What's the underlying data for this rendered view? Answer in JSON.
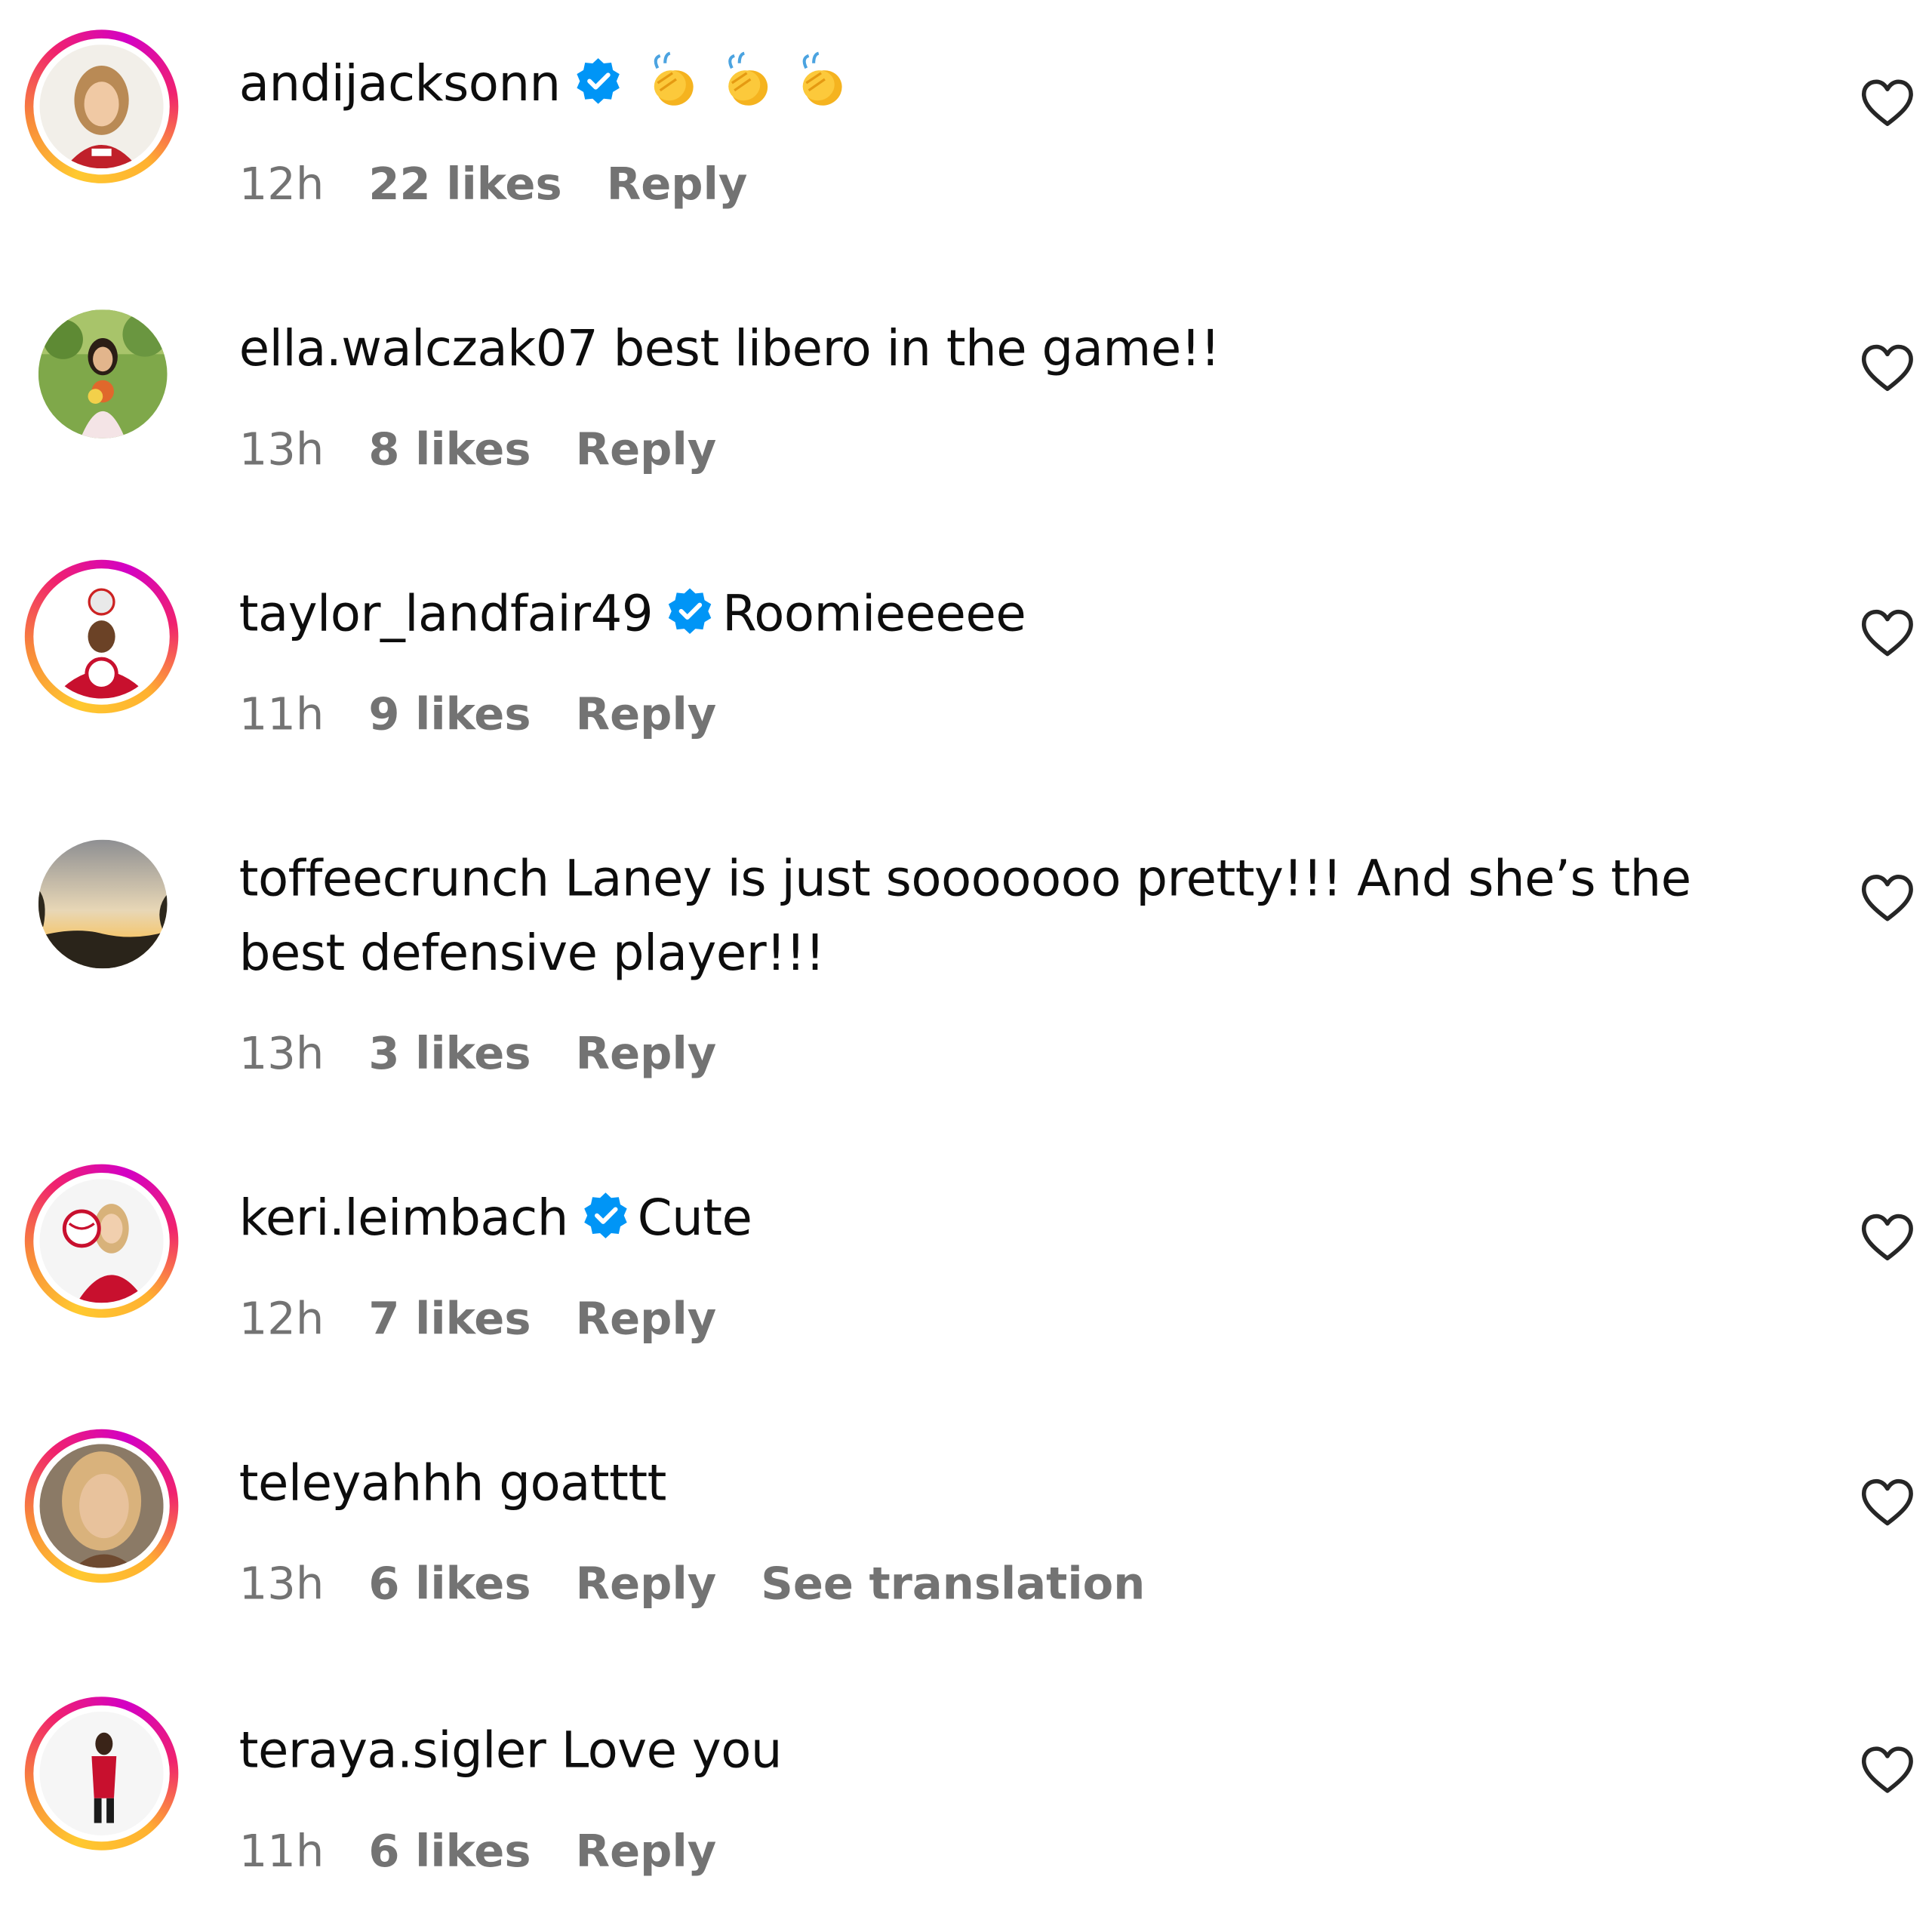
{
  "comments": [
    {
      "username": "andijacksonn",
      "verified": true,
      "text": "",
      "emoji": [
        "clapping-hands",
        "clapping-hands",
        "clapping-hands"
      ],
      "time": "12h",
      "likes": "22 likes",
      "reply": "Reply",
      "avatar_ring": true
    },
    {
      "username": "ella.walczak07",
      "verified": false,
      "text": "best libero in the game!!",
      "time": "13h",
      "likes": "8 likes",
      "reply": "Reply",
      "avatar_ring": false
    },
    {
      "username": "taylor_landfair49",
      "verified": true,
      "text": "Roomieeeee",
      "time": "11h",
      "likes": "9 likes",
      "reply": "Reply",
      "avatar_ring": true
    },
    {
      "username": "toffeecrunch",
      "verified": false,
      "text": "Laney is just sooooooo pretty!!! And she’s the best defensive player!!!",
      "time": "13h",
      "likes": "3 likes",
      "reply": "Reply",
      "avatar_ring": false
    },
    {
      "username": "keri.leimbach",
      "verified": true,
      "text": "Cute",
      "time": "12h",
      "likes": "7 likes",
      "reply": "Reply",
      "avatar_ring": true
    },
    {
      "username": "teleyahhh",
      "verified": false,
      "text": "goatttt",
      "time": "13h",
      "likes": "6 likes",
      "reply": "Reply",
      "see_translation": "See translation",
      "avatar_ring": true
    },
    {
      "username": "teraya.sigler",
      "verified": false,
      "text": "Love you",
      "time": "11h",
      "likes": "6 likes",
      "reply": "Reply",
      "avatar_ring": true
    }
  ],
  "icons": {
    "verified": "verified-badge-icon",
    "like": "heart-outline-icon",
    "emoji": "clapping-hands-emoji"
  },
  "colors": {
    "verified_blue": "#0095f6",
    "meta_gray": "#737373",
    "text": "#0d0d0d"
  }
}
